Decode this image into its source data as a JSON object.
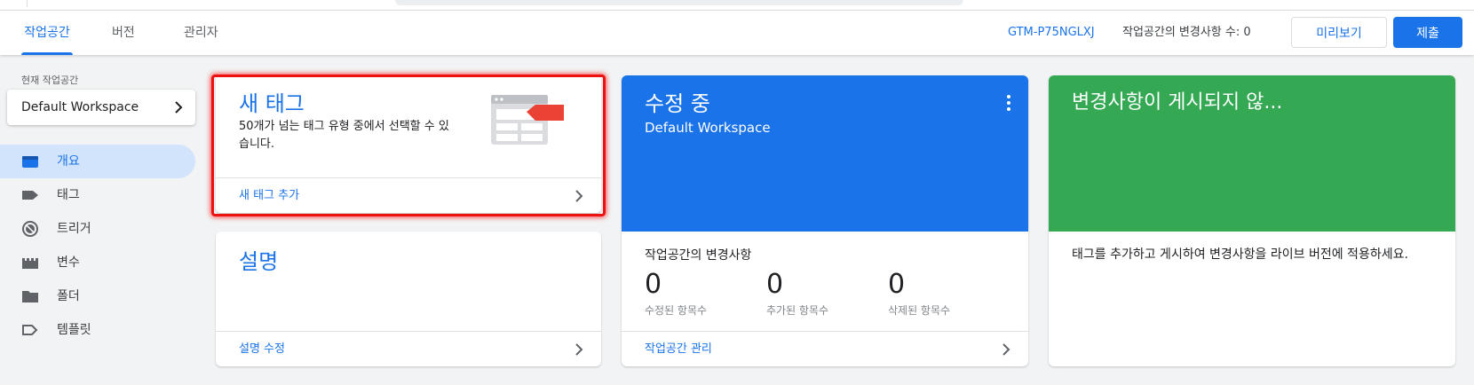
{
  "nav": {
    "tabs": [
      {
        "label": "작업공간"
      },
      {
        "label": "버전"
      },
      {
        "label": "관리자"
      }
    ],
    "container_id": "GTM-P75NGLXJ",
    "changes_count": "작업공간의 변경사항 수: 0",
    "preview_label": "미리보기",
    "submit_label": "제출"
  },
  "sidebar": {
    "workspace_label": "현재 작업공간",
    "workspace_name": "Default Workspace",
    "items": [
      {
        "label": "개요",
        "icon": "overview-icon"
      },
      {
        "label": "태그",
        "icon": "tag-icon"
      },
      {
        "label": "트리거",
        "icon": "trigger-icon"
      },
      {
        "label": "변수",
        "icon": "variable-icon"
      },
      {
        "label": "폴더",
        "icon": "folder-icon"
      },
      {
        "label": "템플릿",
        "icon": "template-icon"
      }
    ]
  },
  "new_tag_card": {
    "title": "새 태그",
    "description": "50개가 넘는 태그 유형 중에서 선택할 수 있습니다.",
    "link": "새 태그 추가"
  },
  "description_card": {
    "title": "설명",
    "link": "설명 수정"
  },
  "editing_card": {
    "title": "수정 중",
    "workspace": "Default Workspace",
    "changes_title": "작업공간의 변경사항",
    "stats": [
      {
        "value": "0",
        "label": "수정된 항목수"
      },
      {
        "value": "0",
        "label": "추가된 항목수"
      },
      {
        "value": "0",
        "label": "삭제된 항목수"
      }
    ],
    "link": "작업공간 관리"
  },
  "unpublished_card": {
    "title": "변경사항이 게시되지 않...",
    "body": "태그를 추가하고 게시하여 변경사항을 라이브 버전에 적용하세요."
  },
  "colors": {
    "accent": "#1a73e8",
    "green": "#34a853",
    "highlight": "#ee1111"
  }
}
